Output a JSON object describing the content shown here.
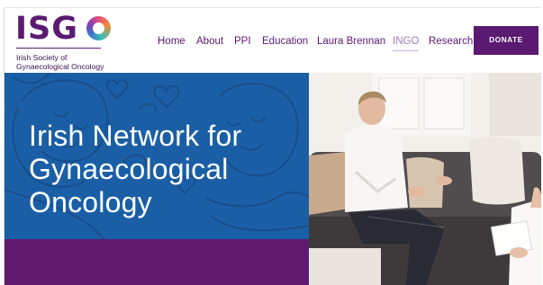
{
  "logo": {
    "wordmark_left": "ISG",
    "wordmark_ring": "O",
    "subtitle_line1": "Irish Society of",
    "subtitle_line2": "Gynaecological Oncology"
  },
  "nav": {
    "items": [
      {
        "label": "Home"
      },
      {
        "label": "About"
      },
      {
        "label": "PPI"
      },
      {
        "label": "Education"
      },
      {
        "label": "Laura Brennan"
      },
      {
        "label": "INGO"
      },
      {
        "label": "Research"
      }
    ],
    "active": "INGO",
    "donate_label": "DONATE"
  },
  "hero": {
    "title_line1": "Irish Network for",
    "title_line2": "Gynaecological",
    "title_line3": "Oncology"
  },
  "colors": {
    "brand_purple": "#5b1a72",
    "hero_blue": "#1a5fa6",
    "band_purple": "#5e1a6d",
    "active_nav": "#a27bc1"
  }
}
